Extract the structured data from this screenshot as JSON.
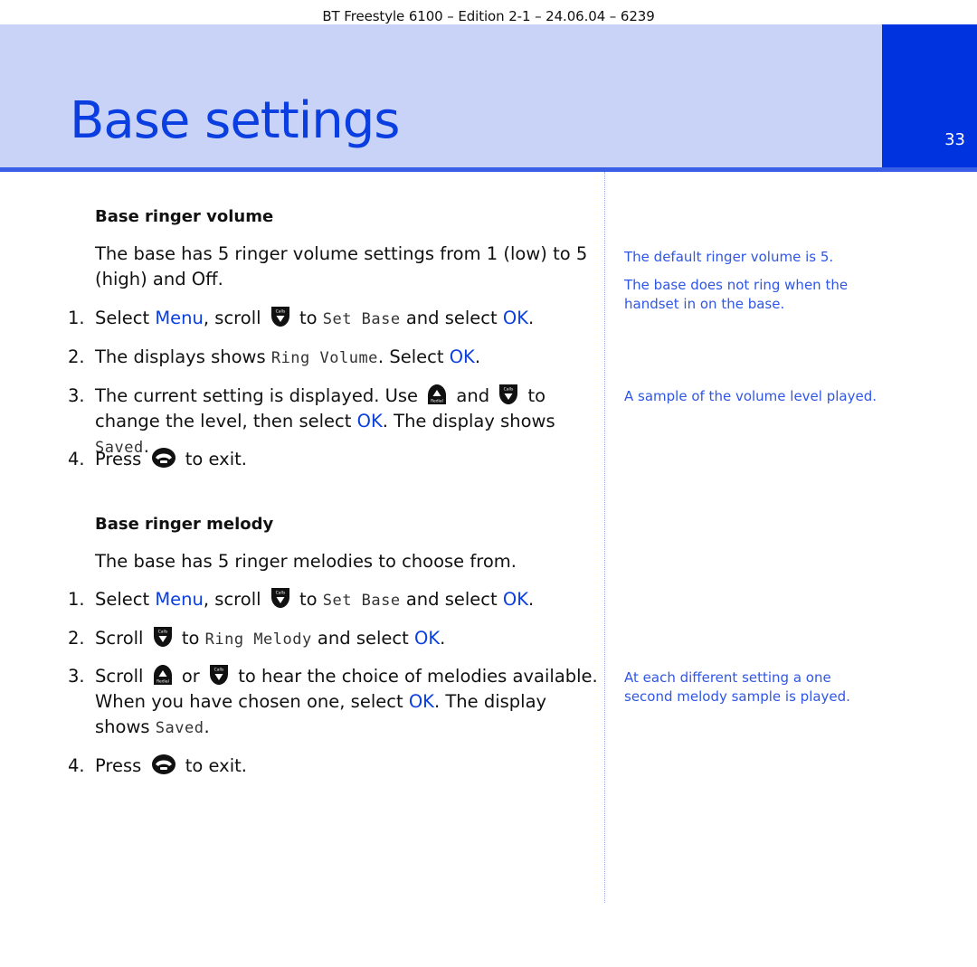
{
  "running_header": "BT Freestyle 6100 – Edition 2-1 – 24.06.04 – 6239",
  "page_title": "Base settings",
  "page_number": "33",
  "colors": {
    "accent_blue": "#0a3ee0",
    "banner_light": "#c8d3f7",
    "banner_tab": "#0033e0",
    "side_note_blue": "#2f56e6"
  },
  "icons": {
    "down_key": "calls-down-key-icon",
    "up_key": "redial-up-key-icon",
    "end_call": "end-call-key-icon",
    "down_key_label": "Calls",
    "up_key_label": "Redial"
  },
  "sections": [
    {
      "heading": "Base ringer volume",
      "intro": "The base has 5 ringer volume settings from 1 (low) to 5 (high) and Off.",
      "steps": [
        {
          "num": "1.",
          "t1": "Select ",
          "menu": "Menu",
          "t2": ", scroll ",
          "t3": " to ",
          "lcd": "Set Base",
          "t4": " and select ",
          "ok": "OK",
          "t5": "."
        },
        {
          "num": "2.",
          "t1": "The displays shows ",
          "lcd": "Ring Volume",
          "t2": ". Select ",
          "ok": "OK",
          "t3": "."
        },
        {
          "num": "3.",
          "t1": "The current setting is displayed. Use ",
          "t2": " and ",
          "t3": " to change the level, then select ",
          "ok": "OK",
          "t4": ". The display shows ",
          "lcd": "Saved",
          "t5": "."
        },
        {
          "num": "4.",
          "t1": "Press ",
          "t2": " to exit."
        }
      ],
      "side_notes": [
        "The default ringer volume is 5.",
        "The base does not ring when the handset in on the base.",
        "A sample of the volume level played."
      ]
    },
    {
      "heading": "Base ringer melody",
      "intro": "The base has 5 ringer melodies to choose from.",
      "steps": [
        {
          "num": "1.",
          "t1": "Select ",
          "menu": "Menu",
          "t2": ", scroll ",
          "t3": " to ",
          "lcd": "Set Base",
          "t4": " and select ",
          "ok": "OK",
          "t5": "."
        },
        {
          "num": "2.",
          "t1": "Scroll ",
          "t2": " to ",
          "lcd": "Ring Melody",
          "t3": " and select ",
          "ok": "OK",
          "t4": "."
        },
        {
          "num": "3.",
          "t1": "Scroll ",
          "t2": " or ",
          "t3": " to hear the choice of melodies available. When you have chosen one, select ",
          "ok": "OK",
          "t4": ". The display shows ",
          "lcd": "Saved",
          "t5": "."
        },
        {
          "num": "4.",
          "t1": "Press ",
          "t2": " to exit."
        }
      ],
      "side_notes": [
        "At each different setting a one second melody sample is played."
      ]
    }
  ]
}
